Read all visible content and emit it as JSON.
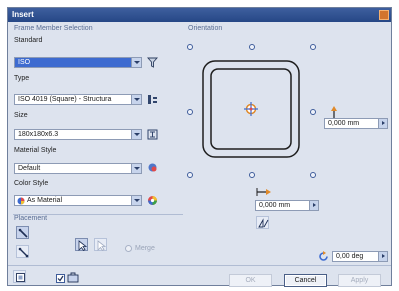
{
  "dialog": {
    "title": "Insert"
  },
  "frame_member_selection": {
    "section_label": "Frame Member Selection",
    "standard": {
      "label": "Standard",
      "value": "ISO"
    },
    "type": {
      "label": "Type",
      "value": "ISO 4019 (Square) - Structura"
    },
    "size": {
      "label": "Size",
      "value": "180x180x6.3"
    },
    "material_style": {
      "label": "Material Style",
      "value": "Default"
    },
    "color_style": {
      "label": "Color Style",
      "value": "As Material"
    }
  },
  "orientation": {
    "section_label": "Orientation",
    "vertical_offset": "0,000 mm",
    "horizontal_offset": "0,000 mm",
    "rotation": "0,00 deg"
  },
  "placement": {
    "section_label": "Placement",
    "merge_label": "Merge"
  },
  "footer": {
    "ok_label": "OK",
    "cancel_label": "Cancel",
    "apply_label": "Apply"
  },
  "colors": {
    "titlebar": "#2f4f90",
    "dialog_bg": "#dde3ee",
    "selected_combo": "#3d6bd0",
    "profile_stroke": "#1e1e1e",
    "close_button": "#d2742e",
    "accent_orange": "#e08a2a"
  },
  "icons": {
    "standard": "filter-icon",
    "type": "profile-type-icon",
    "size": "size-dimension-icon",
    "material": "material-icon",
    "color": "color-wheel-icon",
    "color_swatch": "color-swatch-icon",
    "vertical_offset": "vertical-offset-arrow-icon",
    "horizontal_offset": "horizontal-offset-arrow-icon",
    "mirror": "mirror-profile-icon",
    "rotate": "rotate-icon",
    "placement_edge": "edge-placement-icon",
    "placement_points": "point-placement-icon",
    "select_arrow": "select-arrow-icon",
    "help": "help-icon",
    "options": "options-icon"
  }
}
